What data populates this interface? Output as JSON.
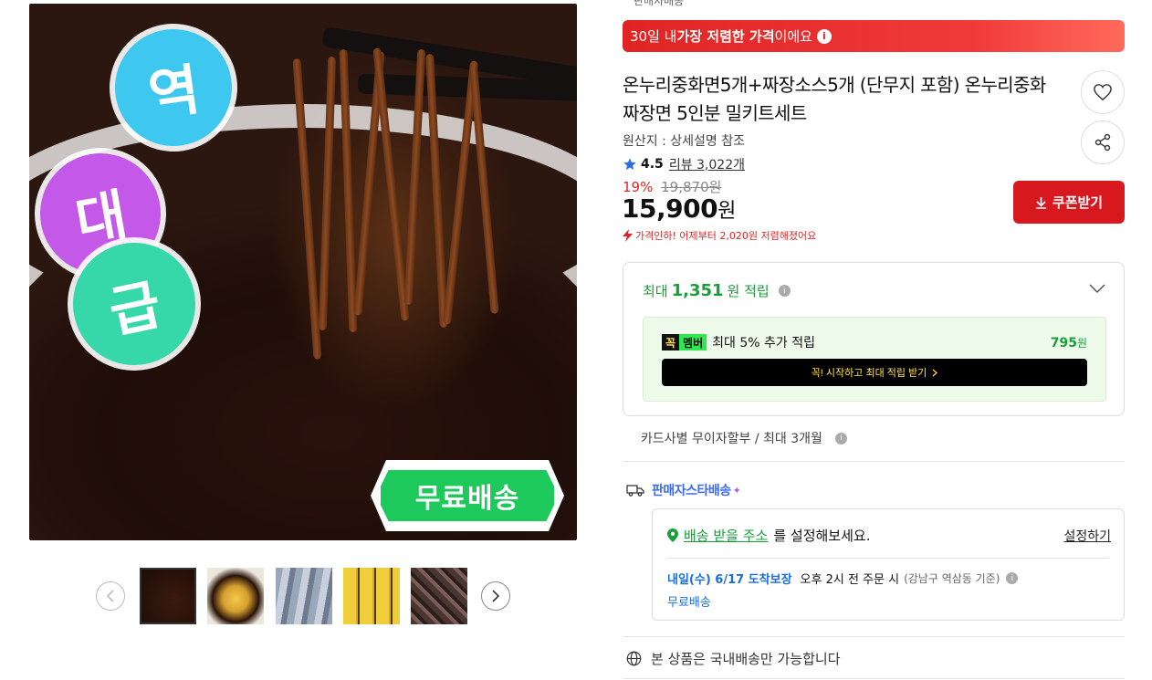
{
  "gallery": {
    "badges": [
      "역",
      "대",
      "급"
    ],
    "banner_text": "무료배송",
    "thumbnails": [
      "thumb-1",
      "thumb-2",
      "thumb-3",
      "thumb-4",
      "thumb-5"
    ],
    "prev_icon": "chevron-left-icon",
    "next_icon": "chevron-right-icon"
  },
  "product": {
    "top_cut_label": "판매자배송",
    "lowest_banner": {
      "pre": "30일 내 ",
      "bold": "가장 저렴한 가격",
      "post": "이에요"
    },
    "title": "온누리중화면5개+짜장소스5개 (단무지 포함) 온누리중화 짜장면 5인분 밀키트세트",
    "origin": "원산지 : 상세설명 참조",
    "rating": "4.5",
    "review_label": "리뷰 3,022개",
    "discount_pct": "19%",
    "original_price": "19,870원",
    "price": "15,900",
    "price_unit": "원",
    "price_drop_note": "가격인하! 어제부터 2,020원 저렴해졌어요",
    "coupon_label": "쿠폰받기"
  },
  "reward": {
    "pre": "최대 ",
    "amount": "1,351",
    "post": "원 적립",
    "member_badge_a": "꼭",
    "member_badge_b": "멤버",
    "member_text": "최대 5% 추가 적립",
    "member_amount": "795",
    "member_unit": "원",
    "member_cta": "꼭! 시작하고 최대 적립 받기"
  },
  "installment": "카드사별 무이자할부 / 최대 3개월",
  "shipping": {
    "type_label": "판매자스타배송",
    "address_link": "배송 받을 주소",
    "address_suffix": "를 설정해보세요.",
    "set_label": "설정하기",
    "arrive_date": "내일(수) 6/17 도착보장",
    "arrive_cond": "오후 2시 전 주문 시",
    "arrive_note": "(강남구 역삼동 기준)",
    "free_shipping": "무료배송"
  },
  "domestic_note": "본 상품은 국내배송만 가능합니다",
  "colors": {
    "accent_red": "#d7191f",
    "green": "#1a9e3a",
    "blue": "#1a6ee0"
  }
}
